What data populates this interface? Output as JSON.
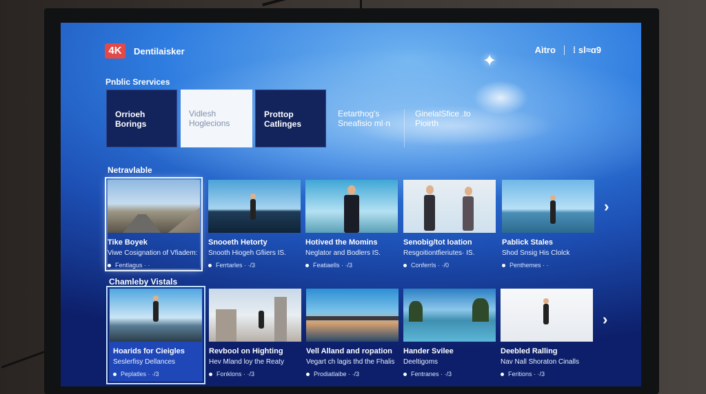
{
  "header": {
    "logo_badge": "4K",
    "brand": "Dentilaisker",
    "right_text_1": "Aìtro",
    "right_text_2": "⁞ sl≈ɑ9"
  },
  "public_services": {
    "title": "Pnblic Srervices",
    "items": [
      {
        "line1": "Orrioeh",
        "line2": "Borings"
      },
      {
        "line1": "Vidlesh",
        "line2": "Hoglecions"
      },
      {
        "line1": "Prottop",
        "line2": "Catlinges"
      },
      {
        "line1": "Eetarthog's",
        "line2": "Sneafisio ml·n"
      },
      {
        "line1": "GinelalSfice .to",
        "line2": "Pioirth"
      }
    ]
  },
  "row1": {
    "title": "Netravlable",
    "cards": [
      {
        "title": "Tike Boyek",
        "sub": "Viwe Cosignation of Vfiadem:",
        "meta": "Fentlagus · ·"
      },
      {
        "title": "Snooeth Hetorty",
        "sub": "Snooth Hiogeh Gfiiers IS.",
        "meta": "Ferrtarles · ·/3"
      },
      {
        "title": "Hotived the Momins",
        "sub": "Neglator and Bodlers IS.",
        "meta": "Featiaells · ·/3"
      },
      {
        "title": "Senobig/tot Ioation",
        "sub": "Resgoitiontfieriutes· IS.",
        "meta": "Conferrls · ·/0"
      },
      {
        "title": "Pablick Stales",
        "sub": "Shod Snsig His Clolck",
        "meta": "Penthemes · ·"
      }
    ]
  },
  "row2": {
    "title": "Chamleby Vistals",
    "cards": [
      {
        "title": "Hoarids for Cieigles",
        "sub": "Seslerfisy Dellances",
        "meta": "Peplatles · ·/3"
      },
      {
        "title": "Revbool on Highting",
        "sub": "Hev Mland loy the Reaty",
        "meta": "Fonklons · ·/3"
      },
      {
        "title": "Vell Alland and ropation",
        "sub": "Vegart ch lagis thd the Fhalis",
        "meta": "Prodiatlaibe · ·/3"
      },
      {
        "title": "Hander Svilee",
        "sub": "Deeltigoms",
        "meta": "Fentranes · ·/3"
      },
      {
        "title": "Deebled Ralling",
        "sub": "Nav Nall Shoraton Cinalls",
        "meta": "Feritions · ·/3"
      }
    ]
  },
  "icons": {
    "arrow": "chevron-right-icon",
    "star": "sparkle-icon"
  },
  "colors": {
    "accent_red": "#e24a4a",
    "screen_blue": "#2f7de0",
    "panel_navy": "#13245c"
  }
}
